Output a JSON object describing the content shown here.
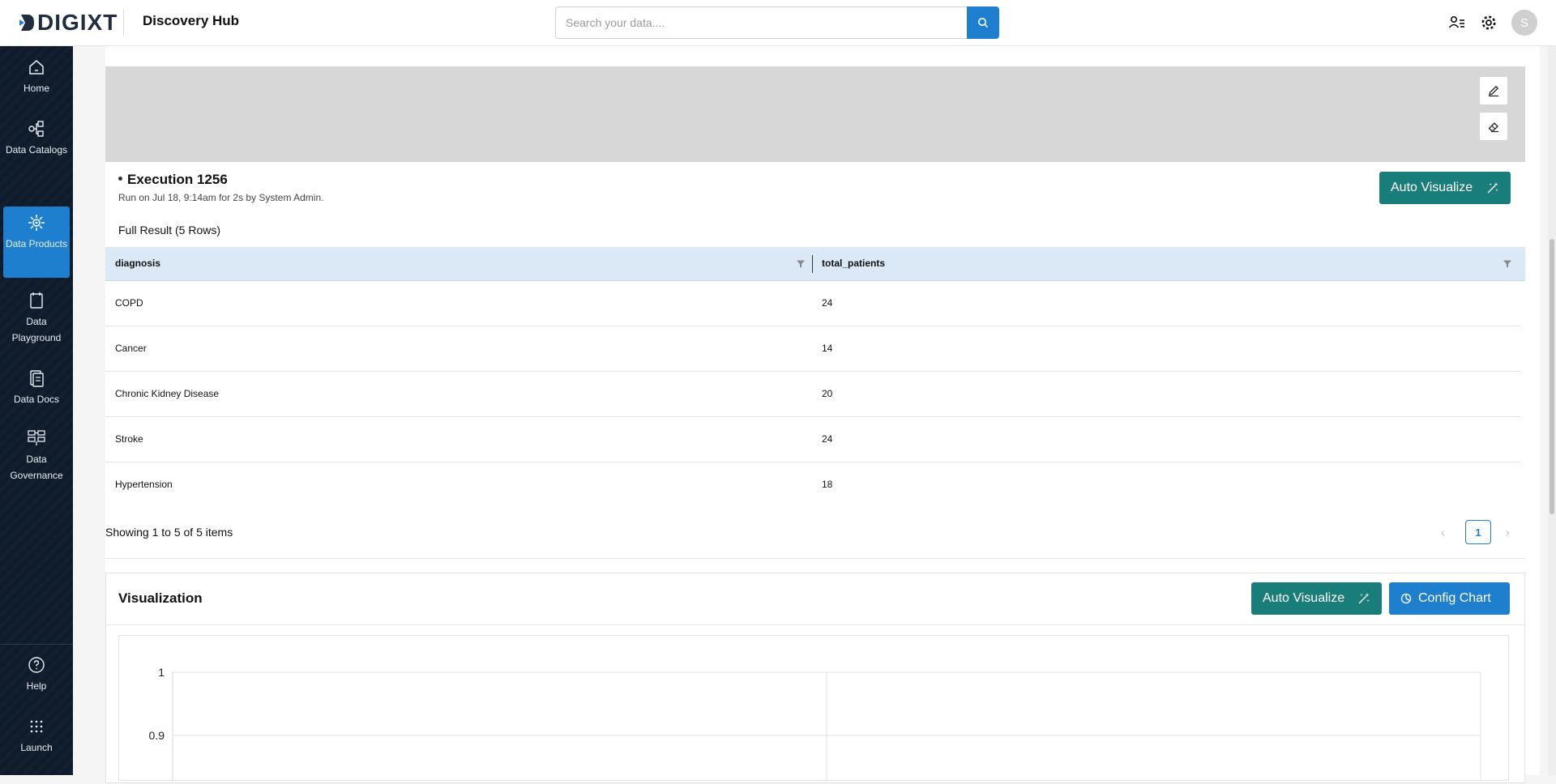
{
  "header": {
    "logo_text": "DIGIXT",
    "title": "Discovery Hub",
    "search_placeholder": "Search your data....",
    "avatar_initial": "S"
  },
  "sidebar": {
    "items": [
      {
        "label": "Home",
        "icon": "home-icon"
      },
      {
        "label": "Data Catalogs",
        "icon": "catalog-icon"
      },
      {
        "label": "Data Products",
        "icon": "data-products-icon",
        "active": true
      },
      {
        "label": "Data Playground",
        "icon": "playground-icon"
      },
      {
        "label": "Data Docs",
        "icon": "docs-icon"
      },
      {
        "label": "Data Governance",
        "icon": "governance-icon"
      }
    ],
    "bottom_items": [
      {
        "label": "Help",
        "icon": "help-icon"
      },
      {
        "label": "Launch",
        "icon": "launch-grid-icon"
      }
    ]
  },
  "execution": {
    "title": "Execution 1256",
    "subtitle": "Run on Jul 18, 9:14am for 2s by System Admin.",
    "auto_visualize_label": "Auto Visualize"
  },
  "result": {
    "label": "Full Result (5 Rows)",
    "columns": [
      "diagnosis",
      "total_patients"
    ],
    "rows": [
      [
        "COPD",
        "24"
      ],
      [
        "Cancer",
        "14"
      ],
      [
        "Chronic Kidney Disease",
        "20"
      ],
      [
        "Stroke",
        "24"
      ],
      [
        "Hypertension",
        "18"
      ]
    ],
    "pagination_text": "Showing 1 to 5 of 5 items",
    "current_page": "1"
  },
  "visualization": {
    "title": "Visualization",
    "auto_visualize_label": "Auto Visualize",
    "config_chart_label": "Config Chart"
  },
  "chart_data": {
    "type": "bar",
    "categories": [],
    "values": [],
    "yticks": [
      "1",
      "0.9"
    ],
    "grid": true
  },
  "colors": {
    "primary": "#1f7fcf",
    "teal": "#197d7a",
    "sidebar": "#0e1b2b",
    "table_header": "#dbe9f6"
  }
}
